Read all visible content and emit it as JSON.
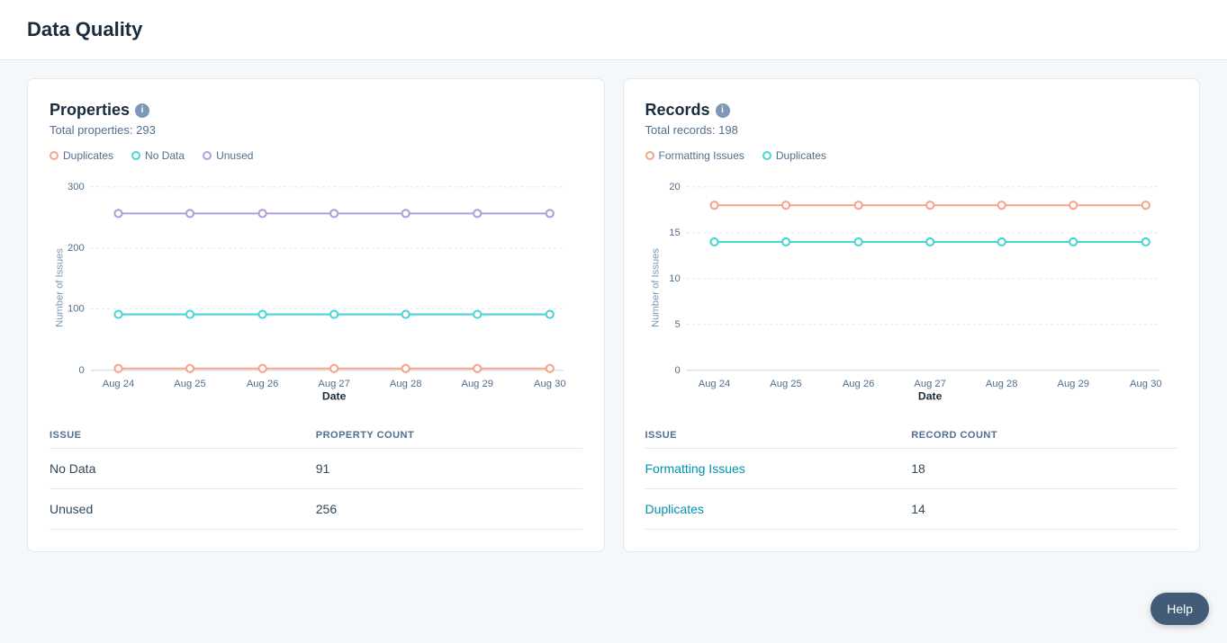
{
  "page": {
    "title": "Data Quality"
  },
  "properties_card": {
    "title": "Properties",
    "subtitle": "Total properties: 293",
    "legend": [
      {
        "id": "duplicates",
        "label": "Duplicates",
        "color": "#f5a48b"
      },
      {
        "id": "no_data",
        "label": "No Data",
        "color": "#48d6d2"
      },
      {
        "id": "unused",
        "label": "Unused",
        "color": "#b39ddb"
      }
    ],
    "chart": {
      "y_axis_label": "Number of Issues",
      "x_axis_title": "Date",
      "dates": [
        "Aug 24",
        "Aug 25",
        "Aug 26",
        "Aug 27",
        "Aug 28",
        "Aug 29",
        "Aug 30"
      ],
      "y_ticks": [
        0,
        100,
        200,
        300
      ],
      "series": [
        {
          "id": "duplicates",
          "color": "#f5a48b",
          "values": [
            2,
            2,
            2,
            2,
            2,
            2,
            2
          ]
        },
        {
          "id": "no_data",
          "color": "#48d6d2",
          "values": [
            91,
            91,
            91,
            91,
            91,
            91,
            91
          ]
        },
        {
          "id": "unused",
          "color": "#b39ddb",
          "values": [
            256,
            256,
            256,
            256,
            256,
            256,
            256
          ]
        }
      ]
    },
    "table": {
      "col1_header": "ISSUE",
      "col2_header": "PROPERTY COUNT",
      "rows": [
        {
          "issue": "No Data",
          "count": "91",
          "is_link": false
        },
        {
          "issue": "Unused",
          "count": "256",
          "is_link": false
        }
      ]
    }
  },
  "records_card": {
    "title": "Records",
    "subtitle": "Total records: 198",
    "legend": [
      {
        "id": "formatting_issues",
        "label": "Formatting Issues",
        "color": "#f5a48b"
      },
      {
        "id": "duplicates",
        "label": "Duplicates",
        "color": "#48d6d2"
      }
    ],
    "chart": {
      "y_axis_label": "Number of Issues",
      "x_axis_title": "Date",
      "dates": [
        "Aug 24",
        "Aug 25",
        "Aug 26",
        "Aug 27",
        "Aug 28",
        "Aug 29",
        "Aug 30"
      ],
      "y_ticks": [
        0,
        5,
        10,
        15,
        20
      ],
      "series": [
        {
          "id": "formatting_issues",
          "color": "#f5a48b",
          "values": [
            18,
            18,
            18,
            18,
            18,
            18,
            18
          ]
        },
        {
          "id": "duplicates",
          "color": "#48d6d2",
          "values": [
            14,
            14,
            14,
            14,
            14,
            14,
            14
          ]
        }
      ]
    },
    "table": {
      "col1_header": "ISSUE",
      "col2_header": "RECORD COUNT",
      "rows": [
        {
          "issue": "Formatting Issues",
          "count": "18",
          "is_link": true
        },
        {
          "issue": "Duplicates",
          "count": "14",
          "is_link": true
        }
      ]
    }
  },
  "help_button": {
    "label": "Help"
  }
}
